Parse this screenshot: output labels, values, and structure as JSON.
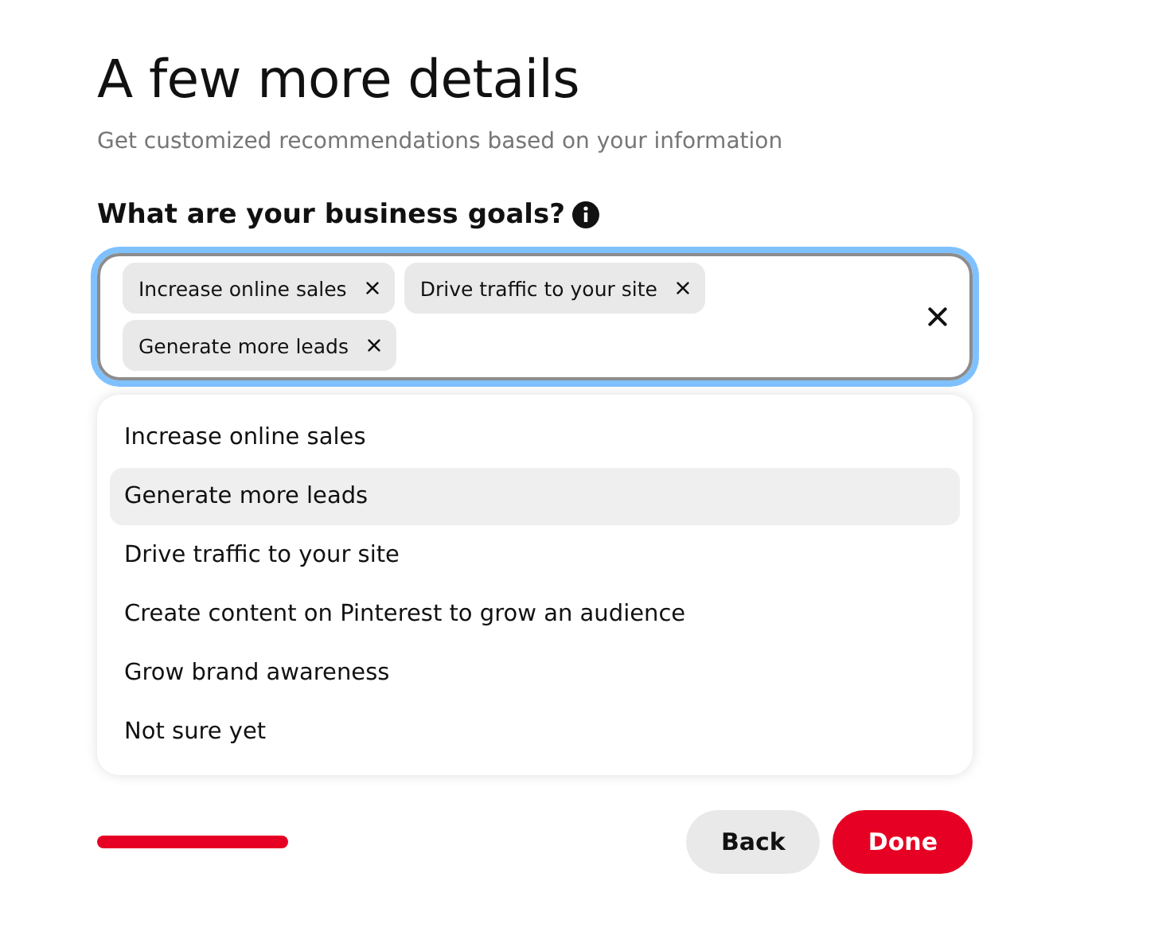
{
  "title": "A few more details",
  "subtitle": "Get customized recommendations based on your information",
  "question": {
    "label": "What are your business goals?"
  },
  "field": {
    "focused": true,
    "tags": [
      {
        "label": "Increase online sales"
      },
      {
        "label": "Drive traffic to your site"
      },
      {
        "label": "Generate more leads"
      }
    ]
  },
  "options": [
    {
      "label": "Increase online sales",
      "selected": false
    },
    {
      "label": "Generate more leads",
      "selected": true
    },
    {
      "label": "Drive traffic to your site",
      "selected": false
    },
    {
      "label": "Create content on Pinterest to grow an audience",
      "selected": false
    },
    {
      "label": "Grow brand awareness",
      "selected": false
    },
    {
      "label": "Not sure yet",
      "selected": false
    }
  ],
  "buttons": [
    {
      "label": "Back",
      "kind": "secondary"
    },
    {
      "label": "Done",
      "kind": "primary"
    }
  ]
}
